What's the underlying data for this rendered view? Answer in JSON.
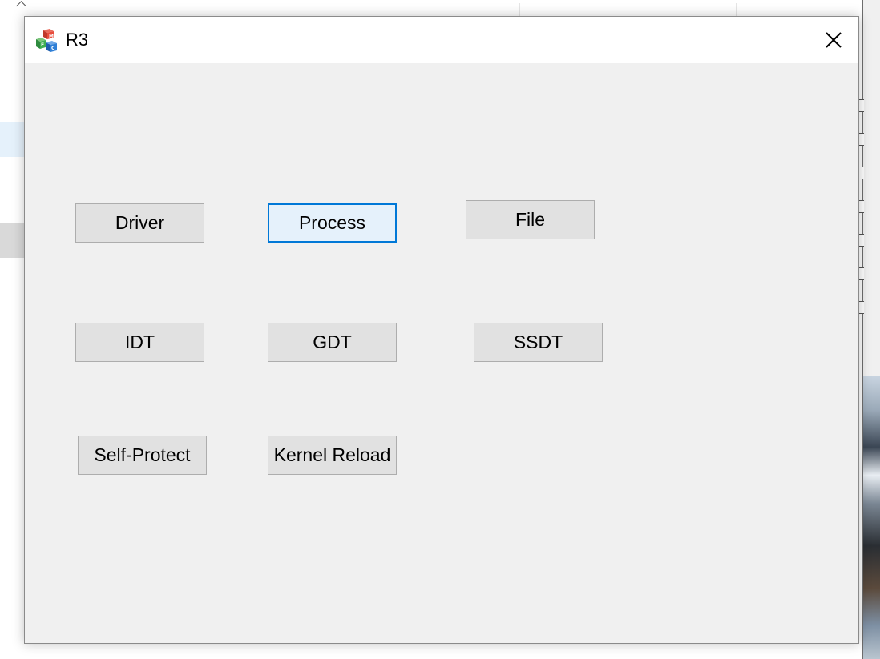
{
  "window": {
    "title": "R3",
    "icon": "mfc-app-icon",
    "close_icon": "close-icon"
  },
  "buttons": {
    "driver": "Driver",
    "process": "Process",
    "file": "File",
    "idt": "IDT",
    "gdt": "GDT",
    "ssdt": "SSDT",
    "self_protect": "Self-Protect",
    "kernel_reload": "Kernel Reload"
  },
  "state": {
    "focused_button": "Process"
  },
  "colors": {
    "dialog_background": "#f0f0f0",
    "button_face": "#e1e1e1",
    "button_border": "#adadad",
    "focus_border": "#0078d7",
    "titlebar": "#ffffff"
  }
}
